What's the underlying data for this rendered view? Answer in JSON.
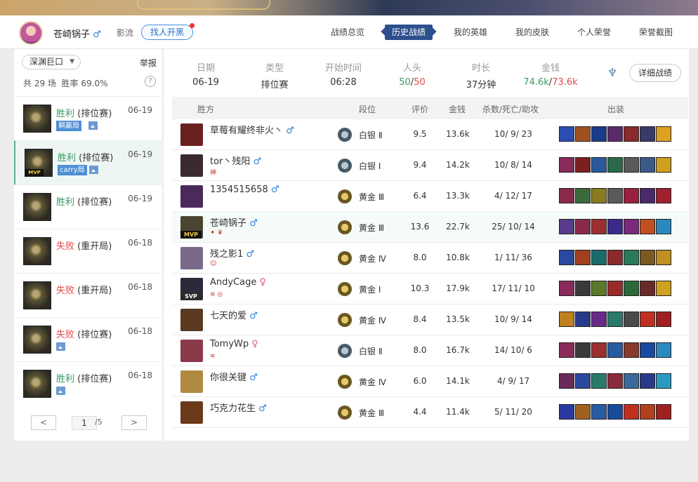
{
  "header": {
    "user_name": "苍崎锅子",
    "gender_symbol": "♂",
    "school": "影流",
    "find_team_button": "找人开黑",
    "nav": [
      "战绩总览",
      "历史战绩",
      "我的英雄",
      "我的皮肤",
      "个人荣誉",
      "荣誉截图"
    ],
    "active_nav": "历史战绩"
  },
  "sidebar": {
    "mode_select": "深渊巨口",
    "report_link": "举报",
    "total_label": "共 29 场",
    "winrate_label": "胜率 69.0%",
    "help_icon": "?",
    "matches": [
      {
        "result": "胜利",
        "mode": "(排位赛)",
        "date": "06-19",
        "tag": "躺赢局",
        "win": true
      },
      {
        "result": "胜利",
        "mode": "(排位赛)",
        "date": "06-19",
        "tag": "carry局",
        "win": true,
        "mvp": "MVP",
        "selected": true
      },
      {
        "result": "胜利",
        "mode": "(排位赛)",
        "date": "06-19",
        "win": true
      },
      {
        "result": "失败",
        "mode": "(重开局)",
        "date": "06-18",
        "win": false
      },
      {
        "result": "失败",
        "mode": "(重开局)",
        "date": "06-18",
        "win": false
      },
      {
        "result": "失败",
        "mode": "(排位赛)",
        "date": "06-18",
        "win": false
      },
      {
        "result": "胜利",
        "mode": "(排位赛)",
        "date": "06-18",
        "win": true
      }
    ],
    "pager": {
      "prev": "<",
      "current": "1",
      "total": "/5",
      "next": ">"
    }
  },
  "summary": {
    "date_label": "日期",
    "date": "06-19",
    "type_label": "类型",
    "type": "排位赛",
    "start_label": "开始时间",
    "start": "06:28",
    "kills_label": "人头",
    "kills_a": "50",
    "kills_sep": "/",
    "kills_b": "50",
    "duration_label": "时长",
    "duration": "37分钟",
    "gold_label": "金钱",
    "gold_a": "74.6k",
    "gold_sep": "/",
    "gold_b": "73.6k",
    "detail_button": "详细战绩"
  },
  "table": {
    "headers": {
      "side": "胜方",
      "rank": "段位",
      "score": "评价",
      "gold": "金钱",
      "kda": "杀数/死亡/助攻",
      "items": "出装"
    },
    "rows": [
      {
        "name": "草莓有耀终非火丶",
        "gender": "♂",
        "rank": "白银 Ⅱ",
        "tier": "silver",
        "score": "9.5",
        "gold": "13.6k",
        "kda": "10/ 9/ 23",
        "hero": "#6b2020",
        "badge": ""
      },
      {
        "name": "tor丶残阳",
        "gender": "♂",
        "rank": "白银 Ⅰ",
        "tier": "silver",
        "score": "9.4",
        "gold": "14.2k",
        "kda": "10/ 8/ 14",
        "hero": "#3a2a30",
        "badge": "神"
      },
      {
        "name": "1354515658",
        "gender": "♂",
        "rank": "黄金 Ⅲ",
        "tier": "gold",
        "score": "6.4",
        "gold": "13.3k",
        "kda": "4/ 12/ 17",
        "hero": "#4a2a5a",
        "badge": ""
      },
      {
        "name": "苍崎锅子",
        "gender": "♂",
        "rank": "黄金 Ⅲ",
        "tier": "gold",
        "score": "13.6",
        "gold": "22.7k",
        "kda": "25/ 10/ 14",
        "hero": "#4a4530",
        "badge": "✦ ♛",
        "mvp": "MVP",
        "me": true
      },
      {
        "name": "残之影1",
        "gender": "♂",
        "rank": "黄金 Ⅳ",
        "tier": "gold",
        "score": "8.0",
        "gold": "10.8k",
        "kda": "1/ 11/ 36",
        "hero": "#7a6a8a",
        "badge": "☺"
      },
      {
        "name": "AndyCage",
        "gender": "♀",
        "rank": "黄金 Ⅰ",
        "tier": "gold",
        "score": "10.3",
        "gold": "17.9k",
        "kda": "17/ 11/ 10",
        "hero": "#2a2a3a",
        "badge": "≡ ◎",
        "mvp": "SVP"
      },
      {
        "name": "七天的爱",
        "gender": "♂",
        "rank": "黄金 Ⅳ",
        "tier": "gold",
        "score": "8.4",
        "gold": "13.5k",
        "kda": "10/ 9/ 14",
        "hero": "#5a3a20",
        "badge": ""
      },
      {
        "name": "TomyWp",
        "gender": "♀",
        "rank": "白银 Ⅱ",
        "tier": "silver",
        "score": "8.0",
        "gold": "16.7k",
        "kda": "14/ 10/ 6",
        "hero": "#8a3a4a",
        "badge": "≋"
      },
      {
        "name": "你很关键",
        "gender": "♂",
        "rank": "黄金 Ⅳ",
        "tier": "gold",
        "score": "6.0",
        "gold": "14.1k",
        "kda": "4/ 9/ 17",
        "hero": "#b08a40",
        "badge": ""
      },
      {
        "name": "巧克力花生",
        "gender": "♂",
        "rank": "黄金 Ⅲ",
        "tier": "gold",
        "score": "4.4",
        "gold": "11.4k",
        "kda": "5/ 11/ 20",
        "hero": "#6a3a1a",
        "badge": ""
      }
    ],
    "item_colors": [
      [
        "#2a4fb0",
        "#a05020",
        "#1a3a8a",
        "#5a2a6a",
        "#8a2a2a",
        "#3a3a6a",
        "#e0a020"
      ],
      [
        "#8a2a5a",
        "#7a2020",
        "#2a5a9a",
        "#2a6a4a",
        "#5a5a5a",
        "#3a5a8a",
        "#d0a020"
      ],
      [
        "#8a2a4a",
        "#3a6a3a",
        "#8a7a20",
        "#5a5a5a",
        "#9a2040",
        "#4a2a6a",
        "#a02030"
      ],
      [
        "#5a3a8a",
        "#8a2a4a",
        "#9a3030",
        "#3a2a8a",
        "#7a2a7a",
        "#c05020",
        "#2a8ac0"
      ],
      [
        "#2a4aa0",
        "#a04020",
        "#1a6a6a",
        "#8a2a2a",
        "#2a7a5a",
        "#7a5a20",
        "#c09020"
      ],
      [
        "#8a2a5a",
        "#3a3a3a",
        "#5a7a2a",
        "#9a2a2a",
        "#2a6a3a",
        "#6a2a2a",
        "#d0a020"
      ],
      [
        "#c08020",
        "#2a3a8a",
        "#6a2a8a",
        "#2a7a6a",
        "#4a4a4a",
        "#c03020",
        "#a02020"
      ],
      [
        "#8a2a5a",
        "#3a3a3a",
        "#9a3030",
        "#2a5aa0",
        "#8a3a2a",
        "#1a4aa0",
        "#2a8ac0"
      ],
      [
        "#6a2a5a",
        "#2a4aa0",
        "#2a7a6a",
        "#8a2a3a",
        "#3a6a9a",
        "#2a3a8a",
        "#2a9ac0"
      ],
      [
        "#2a3aa0",
        "#a06020",
        "#2a5aa0",
        "#1a4a9a",
        "#c03020",
        "#b04020",
        "#a02020"
      ]
    ]
  }
}
